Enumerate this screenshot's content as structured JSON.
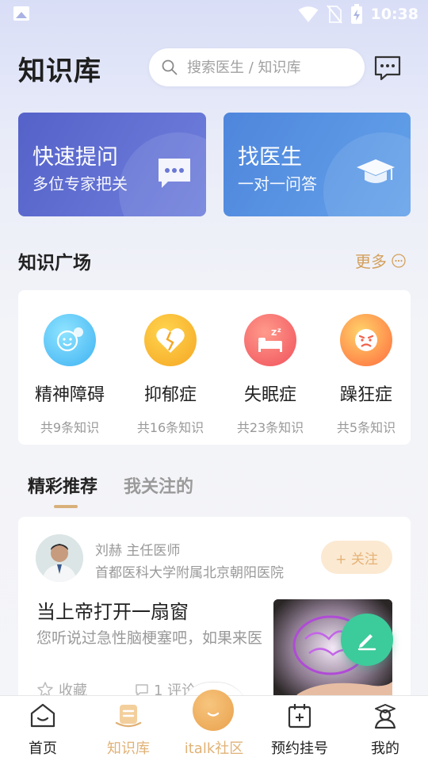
{
  "status_bar": {
    "time": "10:38"
  },
  "header": {
    "title": "知识库",
    "search_placeholder": "搜索医生 / 知识库"
  },
  "feature_cards": [
    {
      "title": "快速提问",
      "subtitle": "多位专家把关"
    },
    {
      "title": "找医生",
      "subtitle": "一对一问答"
    }
  ],
  "knowledge_square": {
    "title": "知识广场",
    "more_label": "更多",
    "categories": [
      {
        "name": "精神障碍",
        "count": "共9条知识"
      },
      {
        "name": "抑郁症",
        "count": "共16条知识"
      },
      {
        "name": "失眠症",
        "count": "共23条知识"
      },
      {
        "name": "躁狂症",
        "count": "共5条知识"
      }
    ]
  },
  "tabs": [
    {
      "label": "精彩推荐",
      "active": true
    },
    {
      "label": "我关注的",
      "active": false
    }
  ],
  "article": {
    "author": "刘赫 主任医师",
    "hospital": "首都医科大学附属北京朝阳医院",
    "follow_label": "+ 关注",
    "title": "当上帝打开一扇窗",
    "excerpt": "您听说过急性脑梗塞吧，如果来医",
    "favorite_label": "收藏",
    "comment_label": "1 评论"
  },
  "bottom_nav": [
    {
      "label": "首页"
    },
    {
      "label": "知识库"
    },
    {
      "label": "italk社区"
    },
    {
      "label": "预约挂号"
    },
    {
      "label": "我的"
    }
  ],
  "colors": {
    "accent": "#e0b276",
    "card_ask": "#5a68cf",
    "card_doctor": "#5693e2",
    "fab": "#3ccb9a"
  }
}
